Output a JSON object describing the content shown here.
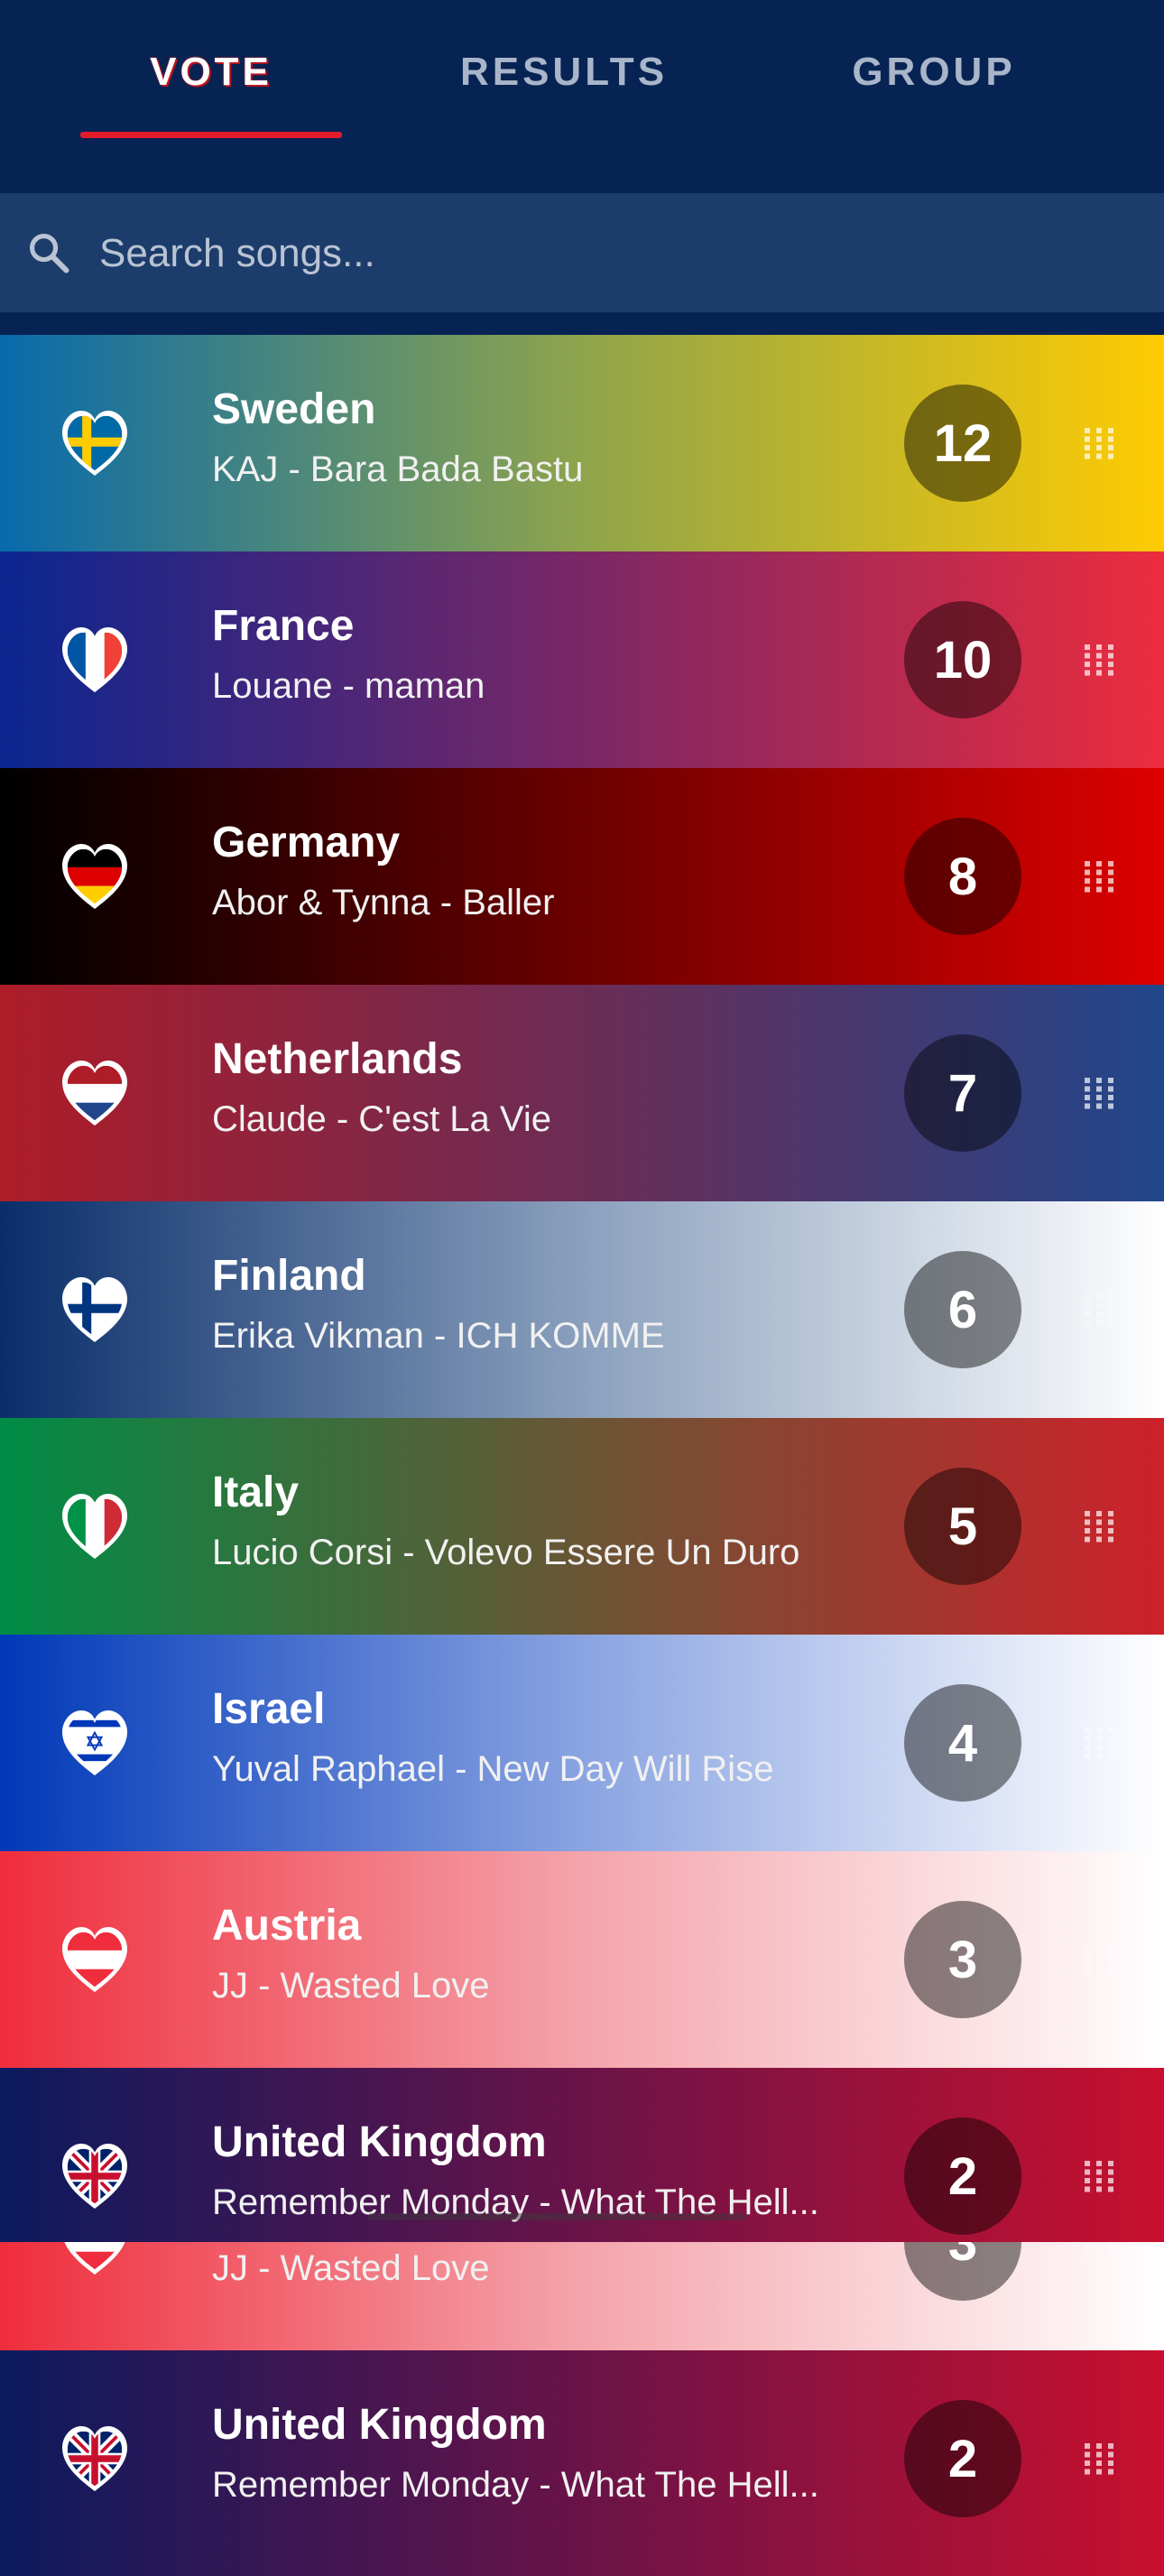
{
  "tabs": [
    {
      "label": "VOTE",
      "active": true
    },
    {
      "label": "RESULTS",
      "active": false
    },
    {
      "label": "GROUP",
      "active": false
    }
  ],
  "search": {
    "placeholder": "Search songs..."
  },
  "entries": [
    {
      "country": "Sweden",
      "song": "KAJ - Bara Bada Bastu",
      "points": "12"
    },
    {
      "country": "France",
      "song": "Louane - maman",
      "points": "10"
    },
    {
      "country": "Germany",
      "song": "Abor & Tynna - Baller",
      "points": "8"
    },
    {
      "country": "Netherlands",
      "song": "Claude - C'est La Vie",
      "points": "7"
    },
    {
      "country": "Finland",
      "song": "Erika Vikman - ICH KOMME",
      "points": "6"
    },
    {
      "country": "Italy",
      "song": "Lucio Corsi - Volevo Essere Un Duro",
      "points": "5"
    },
    {
      "country": "Israel",
      "song": "Yuval Raphael - New Day Will Rise",
      "points": "4"
    },
    {
      "country": "Austria",
      "song": "JJ - Wasted Love",
      "points": "3"
    },
    {
      "country": "United Kingdom",
      "song": "Remember Monday - What The Hell...",
      "points": "2"
    }
  ],
  "ghost_entries": [
    {
      "country": "Austria",
      "song": "JJ - Wasted Love",
      "points": "3"
    },
    {
      "country": "United Kingdom",
      "song": "Remember Monday - What The Hell...",
      "points": "2"
    }
  ],
  "colors": {
    "header_bg": "#072353",
    "search_bg": "#1c3d6b",
    "active_underline": "#e21b2b"
  }
}
